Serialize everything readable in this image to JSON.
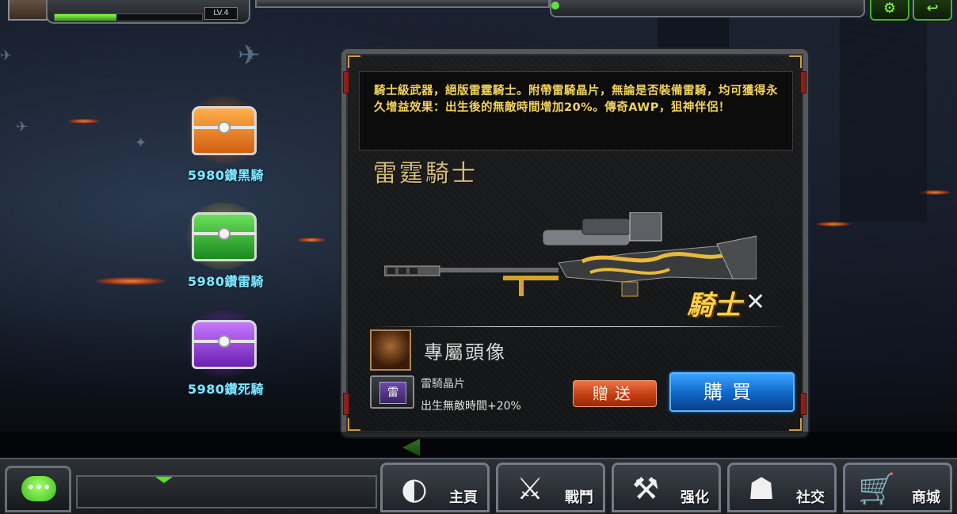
{
  "top": {
    "level_label": "LV.4",
    "xp_fraction": 0.42
  },
  "chests": [
    {
      "label": "5980鑽黑騎",
      "color": "#ff8a1e"
    },
    {
      "label": "5980鑽雷騎",
      "color": "#43d43a"
    },
    {
      "label": "5980鑽死騎",
      "color": "#a845e8"
    }
  ],
  "panel": {
    "description": "騎士級武器，絕版雷霆騎士。附帶雷騎晶片，無論是否裝備雷騎，均可獲得永久增益效果：出生後的無敵時間增加20%。傳奇AWP，狙神伴侶！",
    "weapon_name": "雷霆騎士",
    "badge_text": "騎士",
    "avatar_label": "專屬頭像",
    "chip_icon_text": "雷",
    "chip_name": "雷騎晶片",
    "chip_effect": "出生無敵時間+20%",
    "gift_label": "贈送",
    "buy_label": "購買"
  },
  "nav": [
    {
      "label": "主頁",
      "icon": "home-icon"
    },
    {
      "label": "戰鬥",
      "icon": "pistols-icon"
    },
    {
      "label": "强化",
      "icon": "tools-icon"
    },
    {
      "label": "社交",
      "icon": "people-icon"
    },
    {
      "label": "商城",
      "icon": "cart-icon"
    }
  ],
  "colors": {
    "accent_green": "#57e02e",
    "gold_text": "#f2d25a",
    "gift_button": "#d8501f",
    "buy_button": "#1577dc"
  }
}
